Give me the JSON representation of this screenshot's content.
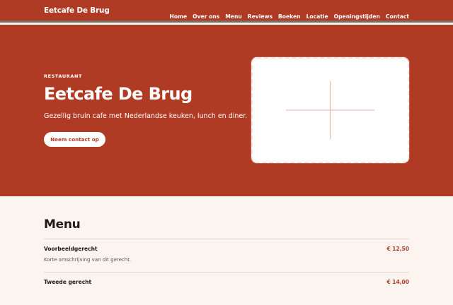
{
  "header": {
    "brand": "Eetcafe De Brug",
    "nav": [
      "Home",
      "Over ons",
      "Menu",
      "Reviews",
      "Boeken",
      "Locatie",
      "Openingstijden",
      "Contact"
    ]
  },
  "hero": {
    "kicker": "RESTAURANT",
    "title": "Eetcafe De Brug",
    "subtitle": "Gezellig bruin cafe met Nederlandse keuken, lunch en diner.",
    "cta_label": "Neem contact op",
    "image_icon": "image-placeholder-icon"
  },
  "menu": {
    "heading": "Menu",
    "items": [
      {
        "name": "Voorbeeldgerecht",
        "description": "Korte omschrijving van dit gerecht.",
        "price": "€ 12,50"
      },
      {
        "name": "Tweede gerecht",
        "description": "",
        "price": "€ 14,00"
      }
    ]
  },
  "colors": {
    "brand_red": "#b03b25",
    "page_cream": "#fbf4ef",
    "text_dark": "#1e1b19"
  }
}
